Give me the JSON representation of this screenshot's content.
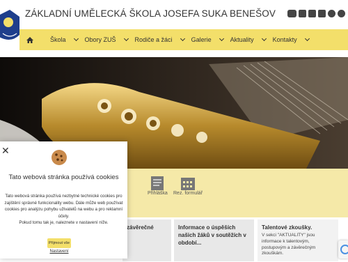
{
  "header": {
    "title": "ZÁKLADNÍ UMĚLECKÁ ŠKOLA JOSEFA SUKA BENEŠOV",
    "social_icons": [
      "youtube-icon",
      "calendar-icon",
      "excel-icon",
      "facebook-icon",
      "instagram-icon",
      "email-icon"
    ]
  },
  "nav": {
    "items": [
      {
        "label": "Škola"
      },
      {
        "label": "Obory ZUŠ"
      },
      {
        "label": "Rodiče a žáci"
      },
      {
        "label": "Galerie"
      },
      {
        "label": "Aktuality"
      },
      {
        "label": "Kontakty"
      }
    ]
  },
  "quick_links": [
    {
      "label": "Přihláška",
      "icon": "application-form-icon"
    },
    {
      "label": "Rez. formulář",
      "icon": "calendar-grid-icon"
    }
  ],
  "cards": [
    {
      "title": "závěrečné",
      "text": ""
    },
    {
      "title": "Informace o úspěších našich žáků v soutěžích v období...",
      "text": ""
    },
    {
      "title": "Talentové zkoušky.",
      "text": "V sekci \"AKTUALITY\" jsou informace k talentovým, postupovým a závěrečným zkouškám."
    }
  ],
  "cookie": {
    "title": "Tato webová stránka používá cookies",
    "body": "Tato webová stránka používá nezbytné technické cookies pro zajištění správné funkcionality webu. Dále může web používat cookies pro analýzu pohybu uživatelů na webu a pro reklamní účely.",
    "body2": "Pokud tomu tak je, naleznete v nastavení níže.",
    "accept": "Přijmout vše",
    "settings": "Nastavení"
  },
  "colors": {
    "accent": "#f3df6a",
    "band": "#f5e9a8",
    "card": "#e8e8e8"
  }
}
